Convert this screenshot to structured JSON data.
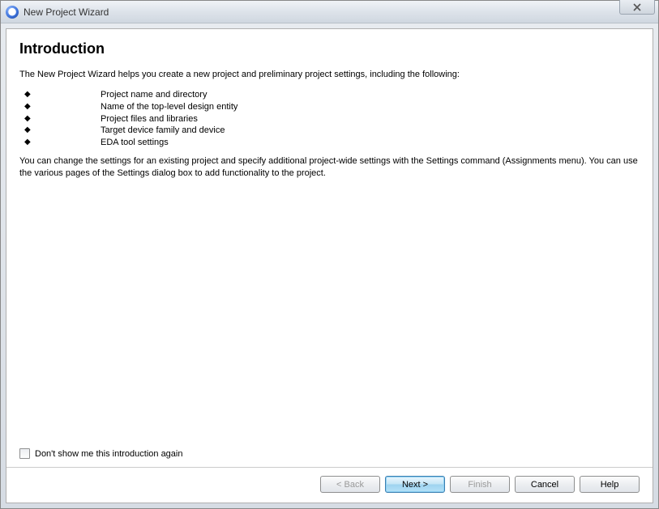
{
  "window": {
    "title": "New Project Wizard"
  },
  "page": {
    "heading": "Introduction",
    "intro": "The New Project Wizard helps you create a new project and preliminary project settings, including the following:",
    "bullets": [
      "Project name and directory",
      "Name of the top-level design entity",
      "Project files and libraries",
      "Target device family and device",
      "EDA tool settings"
    ],
    "body": "You can change the settings for an existing project and specify additional project-wide settings with the Settings command (Assignments menu). You can use the various pages of the Settings dialog box to add functionality to the project.",
    "checkbox_label": "Don't show me this introduction again"
  },
  "buttons": {
    "back": "< Back",
    "next": "Next >",
    "finish": "Finish",
    "cancel": "Cancel",
    "help": "Help"
  }
}
